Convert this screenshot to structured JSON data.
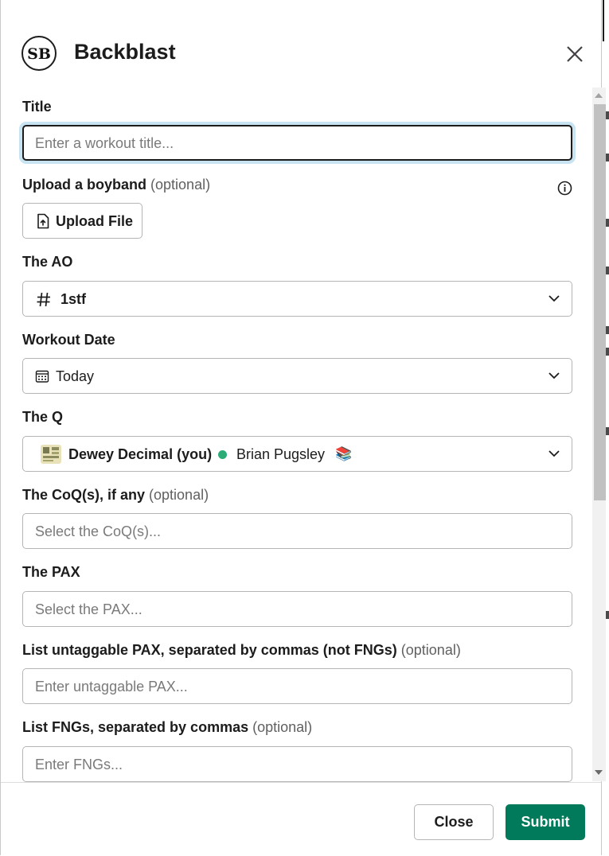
{
  "modal": {
    "title": "Backblast",
    "logo_text": "SB"
  },
  "fields": {
    "title": {
      "label": "Title",
      "placeholder": "Enter a workout title..."
    },
    "upload": {
      "label": "Upload a boyband",
      "optional": "(optional)",
      "button_label": "Upload File"
    },
    "ao": {
      "label": "The AO",
      "value": "1stf"
    },
    "date": {
      "label": "Workout Date",
      "value": "Today"
    },
    "q": {
      "label": "The Q",
      "name": "Dewey Decimal (you)",
      "status": "Brian Pugsley",
      "status_emoji": "📚"
    },
    "coq": {
      "label": "The CoQ(s), if any",
      "optional": "(optional)",
      "placeholder": "Select the CoQ(s)..."
    },
    "pax": {
      "label": "The PAX",
      "placeholder": "Select the PAX..."
    },
    "untaggable": {
      "label": "List untaggable PAX, separated by commas (not FNGs)",
      "optional": "(optional)",
      "placeholder": "Enter untaggable PAX..."
    },
    "fngs": {
      "label": "List FNGs, separated by commas",
      "optional": "(optional)",
      "placeholder": "Enter FNGs..."
    }
  },
  "footer": {
    "close_label": "Close",
    "submit_label": "Submit"
  },
  "colors": {
    "submit_bg": "#007a5a",
    "focus_ring": "#c8e3f2",
    "presence_dot": "#2bac76"
  }
}
